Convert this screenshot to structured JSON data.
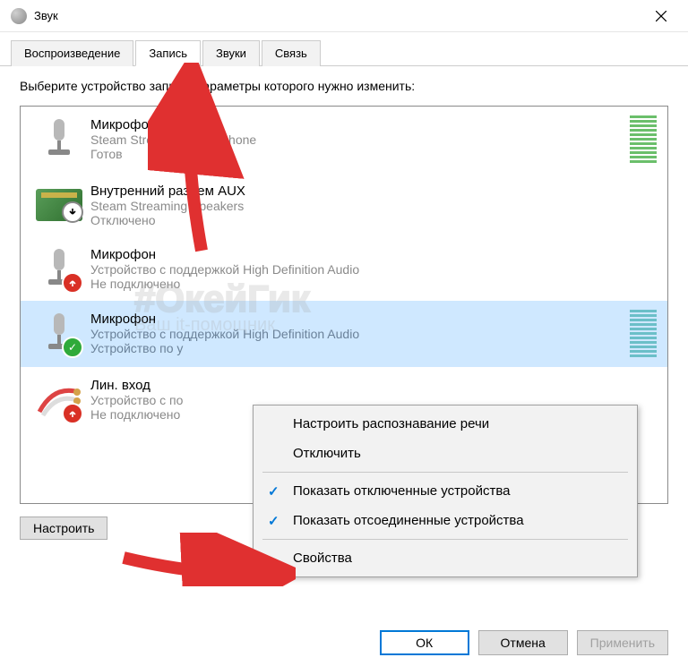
{
  "window": {
    "title": "Звук"
  },
  "tabs": [
    {
      "label": "Воспроизведение"
    },
    {
      "label": "Запись"
    },
    {
      "label": "Звуки"
    },
    {
      "label": "Связь"
    }
  ],
  "instruction": "Выберите устройство записи, параметры которого нужно изменить:",
  "devices": [
    {
      "name": "Микрофон",
      "sub1": "Steam Streaming Microphone",
      "sub2": "Готов",
      "icon": "microphone",
      "status": "none",
      "level_color": "#6bbf6b",
      "selected": false
    },
    {
      "name": "Внутренний разъем  AUX",
      "sub1": "Steam Streaming Speakers",
      "sub2": "Отключено",
      "icon": "sound-card",
      "status": "disabled",
      "level_color": "",
      "selected": false
    },
    {
      "name": "Микрофон",
      "sub1": "Устройство с поддержкой High Definition Audio",
      "sub2": "Не подключено",
      "icon": "microphone",
      "status": "unplugged",
      "level_color": "",
      "selected": false
    },
    {
      "name": "Микрофон",
      "sub1": "Устройство с поддержкой High Definition Audio",
      "sub2": "Устройство по у",
      "icon": "microphone",
      "status": "ok",
      "level_color": "#6bbfc8",
      "selected": true
    },
    {
      "name": "Лин. вход",
      "sub1": "Устройство с по",
      "sub2": "Не подключено",
      "icon": "jack",
      "status": "unplugged",
      "level_color": "",
      "selected": false
    }
  ],
  "configure": {
    "label": "Настроить"
  },
  "context_menu": {
    "items": [
      {
        "label": "Настроить распознавание речи",
        "checked": false
      },
      {
        "label": "Отключить",
        "checked": false
      }
    ],
    "items2": [
      {
        "label": "Показать отключенные устройства",
        "checked": true
      },
      {
        "label": "Показать отсоединенные устройства",
        "checked": true
      }
    ],
    "items3": [
      {
        "label": "Свойства",
        "checked": false
      }
    ]
  },
  "buttons": {
    "ok": "ОК",
    "cancel": "Отмена",
    "apply": "Применить"
  },
  "watermark": {
    "line1": "#ОкейГик",
    "line2": "Ваш it-помощник"
  }
}
